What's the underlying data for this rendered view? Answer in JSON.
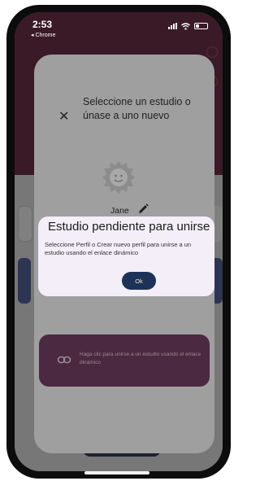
{
  "status_bar": {
    "time": "2:53",
    "back_app": "◂ Chrome"
  },
  "sheet": {
    "close_icon": "close-icon",
    "title": "Seleccione un estudio o únase a uno nuevo",
    "username": "Jane",
    "join_card": {
      "text": "Haga clic para unirse a un estudio usando el enlace dinámico"
    }
  },
  "dialog": {
    "title": "Estudio pendiente para unirse",
    "body": "Seleccione Perfil o Crear nuevo perfil para unirse a un estudio usando el enlace dinámico",
    "ok_label": "Ok"
  },
  "colors": {
    "dialog_bg": "#f3eef7",
    "ok_button": "#1d3259",
    "join_card": "#4b2940",
    "app_header": "#3a1a26"
  }
}
